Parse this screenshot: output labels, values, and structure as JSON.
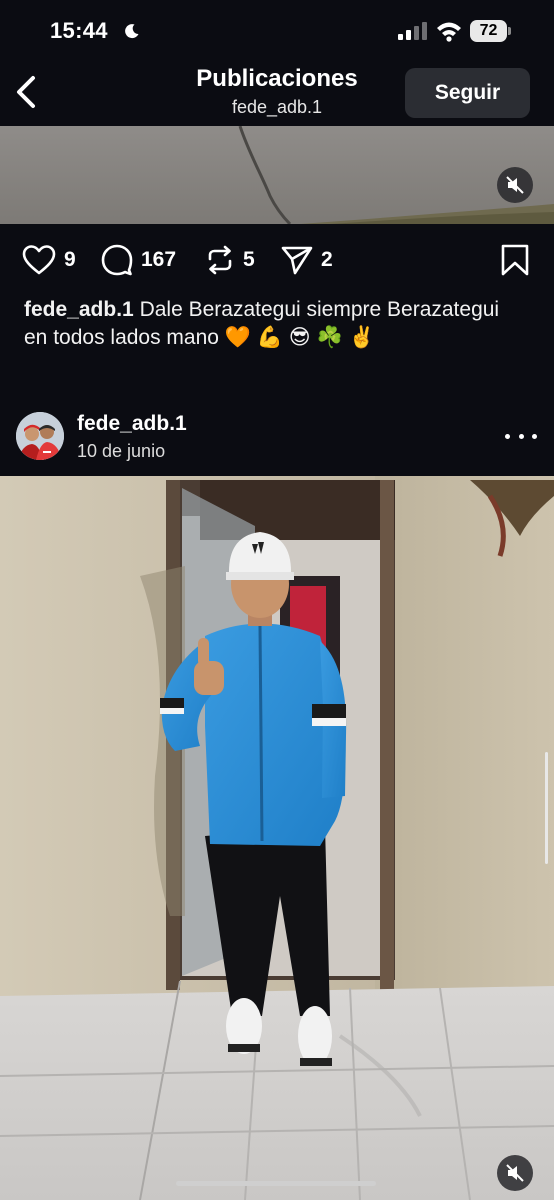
{
  "status_bar": {
    "time": "15:44",
    "battery": "72",
    "icons": [
      "moon-icon",
      "cellular-signal-icon",
      "wifi-icon",
      "battery-icon"
    ]
  },
  "header": {
    "title": "Publicaciones",
    "subtitle": "fede_adb.1",
    "follow_label": "Seguir",
    "back_icon": "chevron-left-icon"
  },
  "previous_post": {
    "muted_icon": "speaker-muted-icon",
    "actions": {
      "likes": "9",
      "comments": "167",
      "reposts": "5",
      "shares": "2"
    },
    "caption": {
      "username": "fede_adb.1",
      "text": "Dale Berazategui siempre Berazategui en todos lados mano 🧡 💪 😎 ☘️ ✌️"
    }
  },
  "post": {
    "username": "fede_adb.1",
    "date": "10 de junio",
    "more_icon": "more-options-icon",
    "muted_icon": "speaker-muted-icon"
  },
  "colors": {
    "background": "#0b0c12",
    "follow_button": "#2b2d33",
    "jacket_blue": "#2a8fd8",
    "wall_beige": "#cdc3ad"
  }
}
